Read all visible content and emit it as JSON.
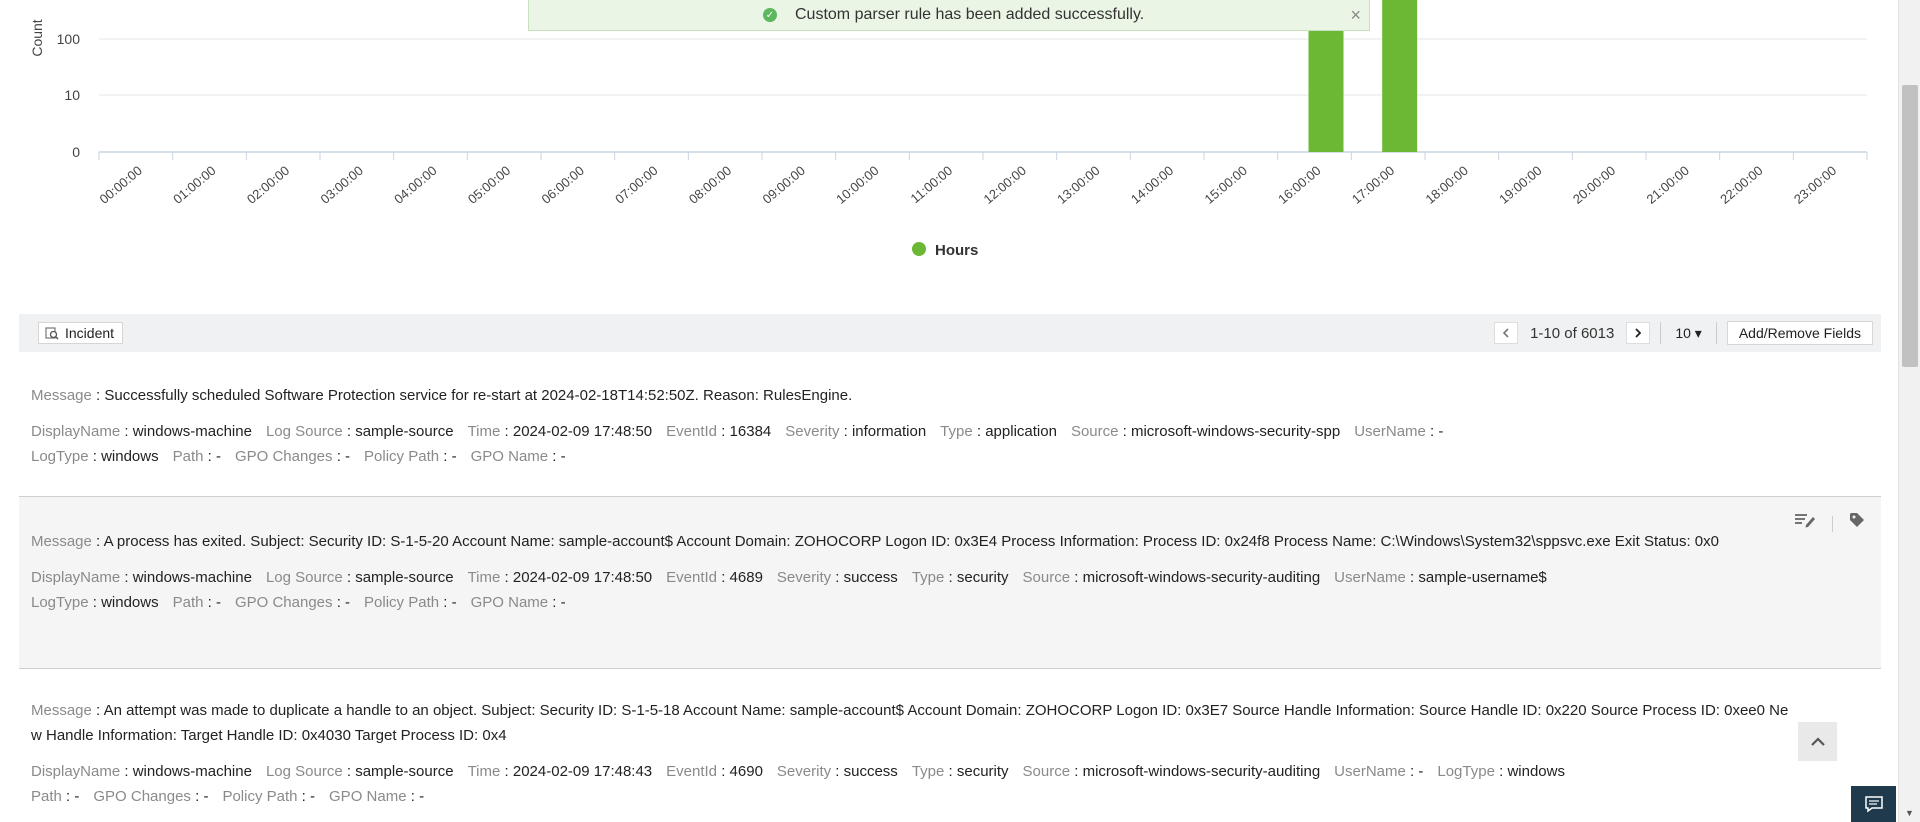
{
  "notification": {
    "text": "Custom parser rule has been added successfully.",
    "status_color": "#5cb85c",
    "close_icon": "×"
  },
  "chart_data": {
    "type": "bar",
    "ylabel": "Count",
    "yscale": "log",
    "yticks": [
      "0",
      "10",
      "100"
    ],
    "categories": [
      "00:00:00",
      "01:00:00",
      "02:00:00",
      "03:00:00",
      "04:00:00",
      "05:00:00",
      "06:00:00",
      "07:00:00",
      "08:00:00",
      "09:00:00",
      "10:00:00",
      "11:00:00",
      "12:00:00",
      "13:00:00",
      "14:00:00",
      "15:00:00",
      "16:00:00",
      "17:00:00",
      "18:00:00",
      "19:00:00",
      "20:00:00",
      "21:00:00",
      "22:00:00",
      "23:00:00"
    ],
    "series": [
      {
        "name": "Hours",
        "color": "#6cb834",
        "values": [
          0,
          0,
          0,
          0,
          0,
          0,
          0,
          0,
          0,
          0,
          0,
          0,
          0,
          0,
          0,
          0,
          1000,
          3000,
          0,
          0,
          0,
          0,
          0,
          0
        ]
      }
    ],
    "legend_position": "bottom",
    "grid": true
  },
  "toolbar": {
    "incident_label": "Incident",
    "page_info": "1-10 of 6013",
    "per_page": "10",
    "add_remove_label": "Add/Remove Fields"
  },
  "logs": [
    {
      "message": "Successfully scheduled Software Protection service for re-start at 2024-02-18T14:52:50Z. Reason: RulesEngine.",
      "fields": [
        [
          "DisplayName",
          "windows-machine"
        ],
        [
          "Log Source",
          "sample-source"
        ],
        [
          "Time",
          "2024-02-09 17:48:50"
        ],
        [
          "EventId",
          "16384"
        ],
        [
          "Severity",
          "information"
        ],
        [
          "Type",
          "application"
        ],
        [
          "Source",
          "microsoft-windows-security-spp"
        ],
        [
          "UserName",
          "-"
        ],
        [
          "LogType",
          "windows"
        ],
        [
          "Path",
          "-"
        ],
        [
          "GPO Changes",
          "-"
        ],
        [
          "Policy Path",
          "-"
        ],
        [
          "GPO Name",
          "-"
        ]
      ]
    },
    {
      "message": "A process has exited. Subject: Security ID: S-1-5-20 Account Name: sample-account$ Account Domain: ZOHOCORP Logon ID: 0x3E4 Process Information: Process ID: 0x24f8 Process Name: C:\\Windows\\System32\\sppsvc.exe Exit Status: 0x0",
      "fields": [
        [
          "DisplayName",
          "windows-machine"
        ],
        [
          "Log Source",
          "sample-source"
        ],
        [
          "Time",
          "2024-02-09 17:48:50"
        ],
        [
          "EventId",
          "4689"
        ],
        [
          "Severity",
          "success"
        ],
        [
          "Type",
          "security"
        ],
        [
          "Source",
          "microsoft-windows-security-auditing"
        ],
        [
          "UserName",
          "sample-username$"
        ],
        [
          "LogType",
          "windows"
        ],
        [
          "Path",
          "-"
        ],
        [
          "GPO Changes",
          "-"
        ],
        [
          "Policy Path",
          "-"
        ],
        [
          "GPO Name",
          "-"
        ]
      ]
    },
    {
      "message": "An attempt was made to duplicate a handle to an object. Subject: Security ID: S-1-5-18 Account Name: sample-account$ Account Domain: ZOHOCORP Logon ID: 0x3E7 Source Handle Information: Source Handle ID: 0x220 Source Process ID: 0xee0 New Handle Information: Target Handle ID: 0x4030 Target Process ID: 0x4",
      "fields": [
        [
          "DisplayName",
          "windows-machine"
        ],
        [
          "Log Source",
          "sample-source"
        ],
        [
          "Time",
          "2024-02-09 17:48:43"
        ],
        [
          "EventId",
          "4690"
        ],
        [
          "Severity",
          "success"
        ],
        [
          "Type",
          "security"
        ],
        [
          "Source",
          "microsoft-windows-security-auditing"
        ],
        [
          "UserName",
          "-"
        ],
        [
          "LogType",
          "windows"
        ],
        [
          "Path",
          "-"
        ],
        [
          "GPO Changes",
          "-"
        ],
        [
          "Policy Path",
          "-"
        ],
        [
          "GPO Name",
          "-"
        ]
      ]
    }
  ],
  "message_key": "Message"
}
